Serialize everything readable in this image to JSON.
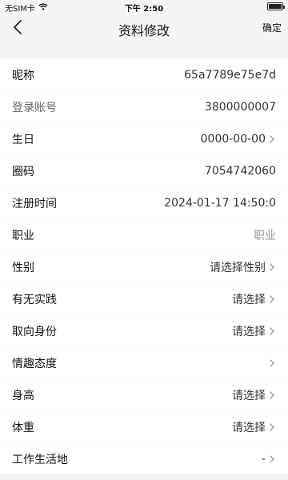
{
  "status_bar": {
    "carrier": "无SIM卡",
    "time": "下午 2:50"
  },
  "nav": {
    "title": "资料修改",
    "confirm_label": "确定",
    "back_icon": "chevron-left-icon"
  },
  "fields": [
    {
      "label": "昵称",
      "value": "65a7789e75e7d",
      "chevron": false,
      "muted_label": false
    },
    {
      "label": "登录账号",
      "value": "3800000007",
      "chevron": false,
      "muted_label": true
    },
    {
      "label": "生日",
      "value": "0000-00-00",
      "chevron": true,
      "muted_label": false
    },
    {
      "label": "圈码",
      "value": "7054742060",
      "chevron": false,
      "muted_label": false
    },
    {
      "label": "注册时间",
      "value": "2024-01-17 14:50:0",
      "chevron": false,
      "muted_label": false
    },
    {
      "label": "职业",
      "value": "职业",
      "chevron": false,
      "muted_label": false,
      "placeholder": true
    },
    {
      "label": "性别",
      "value": "请选择性别",
      "chevron": true,
      "muted_label": false
    },
    {
      "label": "有无实践",
      "value": "请选择",
      "chevron": true,
      "muted_label": false
    },
    {
      "label": "取向身份",
      "value": "请选择",
      "chevron": true,
      "muted_label": false
    },
    {
      "label": "情趣态度",
      "value": "",
      "chevron": true,
      "muted_label": false
    },
    {
      "label": "身高",
      "value": "请选择",
      "chevron": true,
      "muted_label": false
    },
    {
      "label": "体重",
      "value": "请选择",
      "chevron": true,
      "muted_label": false
    },
    {
      "label": "工作生活地",
      "value": "-",
      "chevron": true,
      "muted_label": false
    }
  ]
}
